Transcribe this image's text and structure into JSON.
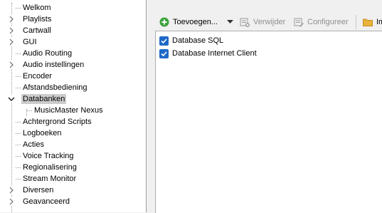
{
  "tree": {
    "items": [
      {
        "label": "Welkom",
        "expandable": false,
        "expanded": false,
        "child": false,
        "selected": false
      },
      {
        "label": "Playlists",
        "expandable": true,
        "expanded": false,
        "child": false,
        "selected": false
      },
      {
        "label": "Cartwall",
        "expandable": true,
        "expanded": false,
        "child": false,
        "selected": false
      },
      {
        "label": "GUI",
        "expandable": true,
        "expanded": false,
        "child": false,
        "selected": false
      },
      {
        "label": "Audio Routing",
        "expandable": false,
        "expanded": false,
        "child": false,
        "selected": false
      },
      {
        "label": "Audio instellingen",
        "expandable": true,
        "expanded": false,
        "child": false,
        "selected": false
      },
      {
        "label": "Encoder",
        "expandable": false,
        "expanded": false,
        "child": false,
        "selected": false
      },
      {
        "label": "Afstandsbediening",
        "expandable": false,
        "expanded": false,
        "child": false,
        "selected": false
      },
      {
        "label": "Databanken",
        "expandable": true,
        "expanded": true,
        "child": false,
        "selected": true
      },
      {
        "label": "MusicMaster Nexus",
        "expandable": false,
        "expanded": false,
        "child": true,
        "selected": false
      },
      {
        "label": "Achtergrond Scripts",
        "expandable": false,
        "expanded": false,
        "child": false,
        "selected": false
      },
      {
        "label": "Logboeken",
        "expandable": false,
        "expanded": false,
        "child": false,
        "selected": false
      },
      {
        "label": "Acties",
        "expandable": false,
        "expanded": false,
        "child": false,
        "selected": false
      },
      {
        "label": "Voice Tracking",
        "expandable": false,
        "expanded": false,
        "child": false,
        "selected": false
      },
      {
        "label": "Regionalisering",
        "expandable": false,
        "expanded": false,
        "child": false,
        "selected": false
      },
      {
        "label": "Stream Monitor",
        "expandable": false,
        "expanded": false,
        "child": false,
        "selected": false
      },
      {
        "label": "Diversen",
        "expandable": true,
        "expanded": false,
        "child": false,
        "selected": false
      },
      {
        "label": "Geavanceerd",
        "expandable": true,
        "expanded": false,
        "child": false,
        "selected": false
      }
    ]
  },
  "toolbar": {
    "add_label": "Toevoegen...",
    "remove_label": "Verwijder",
    "configure_label": "Configureer",
    "import_label": "Im"
  },
  "databases": [
    {
      "label": "Database SQL",
      "checked": true
    },
    {
      "label": "Database Internet Client",
      "checked": true
    }
  ],
  "colors": {
    "checkbox": "#1e69c8",
    "add_icon": "#3aa33a",
    "selection": "#cccccc",
    "folder_icon": "#e8b33a"
  }
}
